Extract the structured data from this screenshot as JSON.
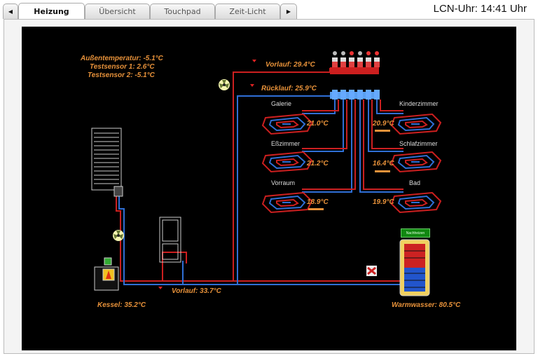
{
  "tabs": [
    {
      "label": "Heizung",
      "active": true
    },
    {
      "label": "Übersicht",
      "active": false
    },
    {
      "label": "Touchpad",
      "active": false
    },
    {
      "label": "Zeit-Licht",
      "active": false
    }
  ],
  "nav": {
    "prev": "◀",
    "next": "▶"
  },
  "clock": "LCN-Uhr: 14:41 Uhr",
  "sensors": {
    "aussen": "Außentemperatur: -5.1°C",
    "test1": "Testsensor 1: 2.6°C",
    "test2": "Testsensor 2: -5.1°C"
  },
  "flows": {
    "vorlauf_top": "Vorlauf: 29.4°C",
    "ruecklauf": "Rücklauf: 25.9°C",
    "vorlauf_bottom": "Vorlauf: 33.7°C"
  },
  "rooms": [
    {
      "name": "Galerie",
      "temp": "21.0°C",
      "heating": false
    },
    {
      "name": "Kinderzimmer",
      "temp": "20.9°C",
      "heating": true
    },
    {
      "name": "Eßzimmer",
      "temp": "21.2°C",
      "heating": false
    },
    {
      "name": "Schlafzimmer",
      "temp": "16.4°C",
      "heating": true
    },
    {
      "name": "Vorraum",
      "temp": "18.9°C",
      "heating": true
    },
    {
      "name": "Bad",
      "temp": "19.9°C",
      "heating": false
    }
  ],
  "kessel": "Kessel: 35.2°C",
  "warmwasser": "Warmwasser: 80.5°C",
  "storage_badge": "Nachheizen",
  "valve_leds": [
    "off",
    "off",
    "on",
    "off",
    "on",
    "on"
  ],
  "colors": {
    "accent": "#e8923a",
    "supply": "#cc1f1f",
    "return": "#2f6fd6",
    "background": "#000000"
  }
}
